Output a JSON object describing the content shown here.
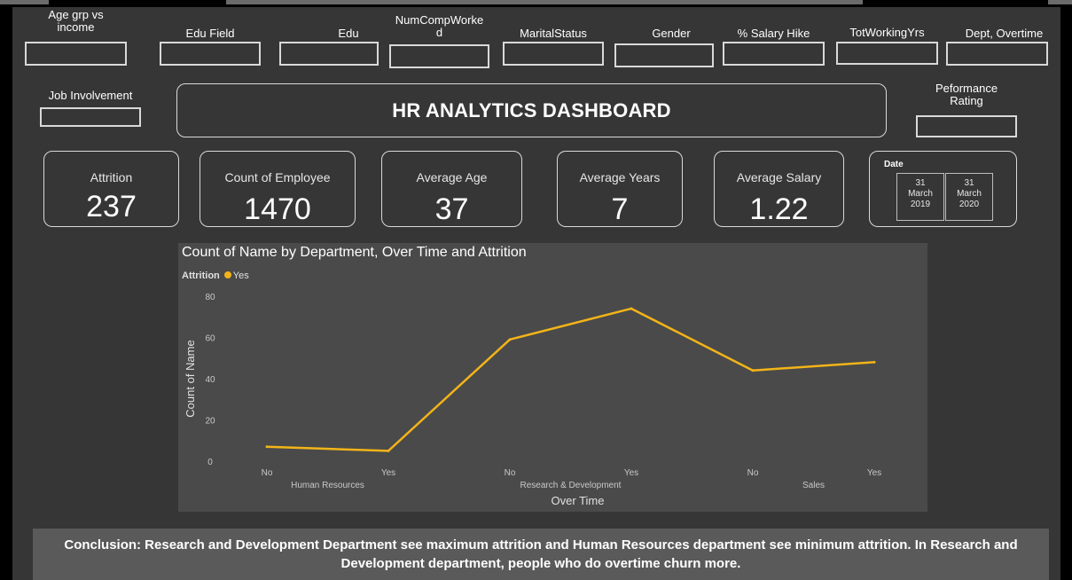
{
  "dashboard": {
    "title": "HR ANALYTICS DASHBOARD"
  },
  "slicers": {
    "age_group": "Age grp vs income",
    "edu_field": "Edu Field",
    "edu": "Edu",
    "num_comp_worked": "NumCompWorked",
    "marital_status": "MaritalStatus",
    "gender": "Gender",
    "salary_hike": "% Salary Hike",
    "tot_working_yrs": "TotWorkingYrs",
    "dept_overtime": "Dept, Overtime",
    "job_involvement": "Job Involvement",
    "performance_rating": "Peformance Rating"
  },
  "kpis": {
    "attrition": {
      "label": "Attrition",
      "value": "237"
    },
    "employees": {
      "label": "Count of Employee",
      "value": "1470"
    },
    "avg_age": {
      "label": "Average Age",
      "value": "37"
    },
    "avg_years": {
      "label": "Average Years",
      "value": "7"
    },
    "avg_salary": {
      "label": "Average Salary",
      "value": "1.22"
    }
  },
  "date_slicer": {
    "label": "Date",
    "start": {
      "day": "31",
      "month": "March",
      "year": "2019"
    },
    "end": {
      "day": "31",
      "month": "March",
      "year": "2020"
    }
  },
  "colors": {
    "background": "#363636",
    "chart_bg": "#4a4a4a",
    "line": "#f2b418",
    "border": "#d9d9d9"
  },
  "chart_data": {
    "type": "line",
    "title": "Count of Name by Department, Over Time and Attrition",
    "xlabel": "Over Time",
    "ylabel": "Count of Name",
    "ylim": [
      0,
      80
    ],
    "yticks": [
      0,
      20,
      40,
      60,
      80
    ],
    "legend_title": "Attrition",
    "legend_position": "top-left",
    "grid": false,
    "groups": [
      "Human Resources",
      "Research & Development",
      "Sales"
    ],
    "categories": [
      "No",
      "Yes",
      "No",
      "Yes",
      "No",
      "Yes"
    ],
    "series": [
      {
        "name": "Yes",
        "color": "#f2b418",
        "values": [
          7,
          5,
          59,
          74,
          44,
          48
        ]
      }
    ]
  },
  "conclusion": {
    "text": "Conclusion: Research and Development Department see maximum attrition and Human Resources department see minimum attrition. In Research and Development department, people who do overtime churn more."
  }
}
